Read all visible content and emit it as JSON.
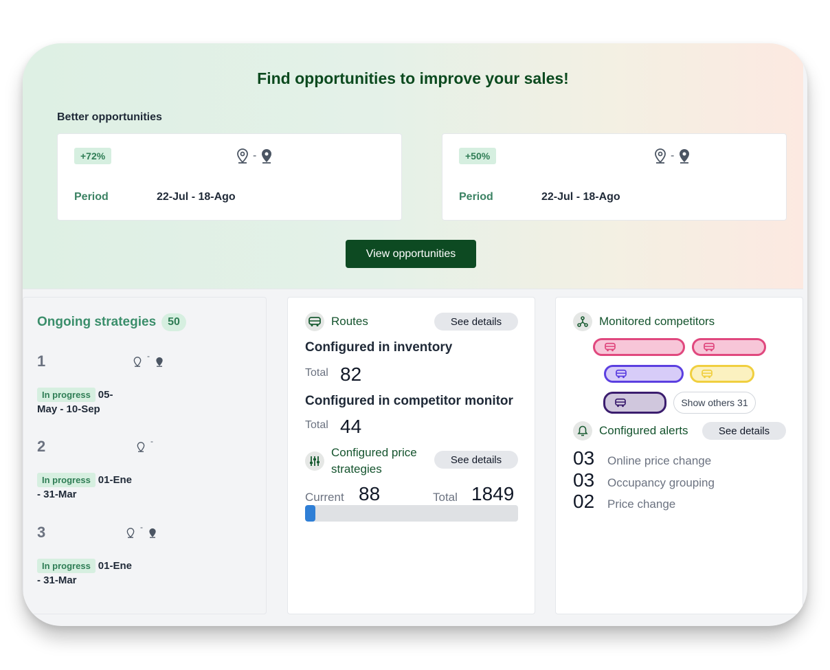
{
  "hero": {
    "title": "Find opportunities to improve your sales!",
    "better_label": "Better opportunities",
    "cards": [
      {
        "badge": "+72%",
        "separator": "-",
        "period_label": "Period",
        "period_value": "22-Jul - 18-Ago"
      },
      {
        "badge": "+50%",
        "separator": "-",
        "period_label": "Period",
        "period_value": "22-Jul - 18-Ago"
      }
    ],
    "view_button": "View opportunities"
  },
  "strategies": {
    "title": "Ongoing strategies",
    "count": "50",
    "items": [
      {
        "num": "1",
        "status": "In progress",
        "dates_a": "05-",
        "dates_b": "May - 10-Sep"
      },
      {
        "num": "2",
        "status": "In progress",
        "dates_a": "01-Ene",
        "dates_b": "- 31-Mar"
      },
      {
        "num": "3",
        "status": "In progress",
        "dates_a": "01-Ene",
        "dates_b": "- 31-Mar"
      }
    ]
  },
  "routes": {
    "title": "Routes",
    "see_details": "See details",
    "inventory_heading": "Configured in inventory",
    "inventory_total_label": "Total",
    "inventory_total": "82",
    "monitor_heading": "Configured in competitor monitor",
    "monitor_total_label": "Total",
    "monitor_total": "44",
    "price_title": "Configured price strategies",
    "price_see_details": "See details",
    "current_label": "Current",
    "current_value": "88",
    "total_label": "Total",
    "total_value": "1849",
    "progress": 0.0476
  },
  "competitors": {
    "title": "Monitored competitors",
    "pills": [
      {
        "color": "#e0487e",
        "fill": "#f7c6d8"
      },
      {
        "color": "#e0487e",
        "fill": "#f7c6d8"
      },
      {
        "color": "#5b3fe0",
        "fill": "#d7ccf8"
      },
      {
        "color": "#f0cf3f",
        "fill": "#fbf1c0"
      },
      {
        "color": "#3b1d6e",
        "fill": "#d0c7dd"
      }
    ],
    "show_others": "Show others 31",
    "alerts_title": "Configured alerts",
    "alerts_see_details": "See details",
    "alerts": [
      {
        "num": "03",
        "label": "Online price change"
      },
      {
        "num": "03",
        "label": "Occupancy grouping"
      },
      {
        "num": "02",
        "label": "Price change"
      }
    ]
  }
}
